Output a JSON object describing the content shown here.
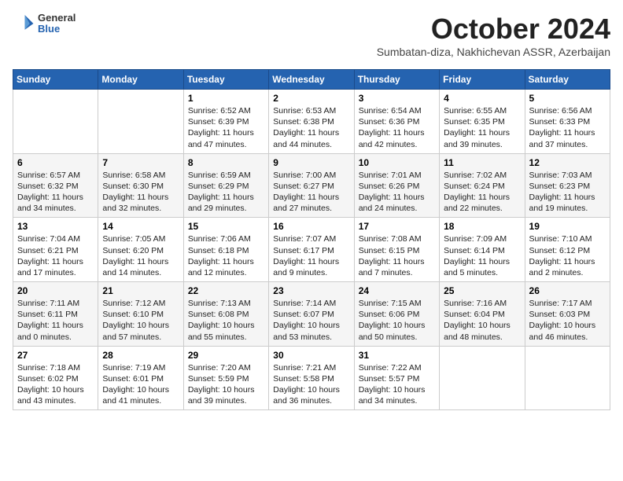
{
  "header": {
    "logo_general": "General",
    "logo_blue": "Blue",
    "month_title": "October 2024",
    "subtitle": "Sumbatan-diza, Nakhichevan ASSR, Azerbaijan"
  },
  "weekdays": [
    "Sunday",
    "Monday",
    "Tuesday",
    "Wednesday",
    "Thursday",
    "Friday",
    "Saturday"
  ],
  "weeks": [
    [
      {
        "day": "",
        "info": ""
      },
      {
        "day": "",
        "info": ""
      },
      {
        "day": "1",
        "info": "Sunrise: 6:52 AM\nSunset: 6:39 PM\nDaylight: 11 hours\nand 47 minutes."
      },
      {
        "day": "2",
        "info": "Sunrise: 6:53 AM\nSunset: 6:38 PM\nDaylight: 11 hours\nand 44 minutes."
      },
      {
        "day": "3",
        "info": "Sunrise: 6:54 AM\nSunset: 6:36 PM\nDaylight: 11 hours\nand 42 minutes."
      },
      {
        "day": "4",
        "info": "Sunrise: 6:55 AM\nSunset: 6:35 PM\nDaylight: 11 hours\nand 39 minutes."
      },
      {
        "day": "5",
        "info": "Sunrise: 6:56 AM\nSunset: 6:33 PM\nDaylight: 11 hours\nand 37 minutes."
      }
    ],
    [
      {
        "day": "6",
        "info": "Sunrise: 6:57 AM\nSunset: 6:32 PM\nDaylight: 11 hours\nand 34 minutes."
      },
      {
        "day": "7",
        "info": "Sunrise: 6:58 AM\nSunset: 6:30 PM\nDaylight: 11 hours\nand 32 minutes."
      },
      {
        "day": "8",
        "info": "Sunrise: 6:59 AM\nSunset: 6:29 PM\nDaylight: 11 hours\nand 29 minutes."
      },
      {
        "day": "9",
        "info": "Sunrise: 7:00 AM\nSunset: 6:27 PM\nDaylight: 11 hours\nand 27 minutes."
      },
      {
        "day": "10",
        "info": "Sunrise: 7:01 AM\nSunset: 6:26 PM\nDaylight: 11 hours\nand 24 minutes."
      },
      {
        "day": "11",
        "info": "Sunrise: 7:02 AM\nSunset: 6:24 PM\nDaylight: 11 hours\nand 22 minutes."
      },
      {
        "day": "12",
        "info": "Sunrise: 7:03 AM\nSunset: 6:23 PM\nDaylight: 11 hours\nand 19 minutes."
      }
    ],
    [
      {
        "day": "13",
        "info": "Sunrise: 7:04 AM\nSunset: 6:21 PM\nDaylight: 11 hours\nand 17 minutes."
      },
      {
        "day": "14",
        "info": "Sunrise: 7:05 AM\nSunset: 6:20 PM\nDaylight: 11 hours\nand 14 minutes."
      },
      {
        "day": "15",
        "info": "Sunrise: 7:06 AM\nSunset: 6:18 PM\nDaylight: 11 hours\nand 12 minutes."
      },
      {
        "day": "16",
        "info": "Sunrise: 7:07 AM\nSunset: 6:17 PM\nDaylight: 11 hours\nand 9 minutes."
      },
      {
        "day": "17",
        "info": "Sunrise: 7:08 AM\nSunset: 6:15 PM\nDaylight: 11 hours\nand 7 minutes."
      },
      {
        "day": "18",
        "info": "Sunrise: 7:09 AM\nSunset: 6:14 PM\nDaylight: 11 hours\nand 5 minutes."
      },
      {
        "day": "19",
        "info": "Sunrise: 7:10 AM\nSunset: 6:12 PM\nDaylight: 11 hours\nand 2 minutes."
      }
    ],
    [
      {
        "day": "20",
        "info": "Sunrise: 7:11 AM\nSunset: 6:11 PM\nDaylight: 11 hours\nand 0 minutes."
      },
      {
        "day": "21",
        "info": "Sunrise: 7:12 AM\nSunset: 6:10 PM\nDaylight: 10 hours\nand 57 minutes."
      },
      {
        "day": "22",
        "info": "Sunrise: 7:13 AM\nSunset: 6:08 PM\nDaylight: 10 hours\nand 55 minutes."
      },
      {
        "day": "23",
        "info": "Sunrise: 7:14 AM\nSunset: 6:07 PM\nDaylight: 10 hours\nand 53 minutes."
      },
      {
        "day": "24",
        "info": "Sunrise: 7:15 AM\nSunset: 6:06 PM\nDaylight: 10 hours\nand 50 minutes."
      },
      {
        "day": "25",
        "info": "Sunrise: 7:16 AM\nSunset: 6:04 PM\nDaylight: 10 hours\nand 48 minutes."
      },
      {
        "day": "26",
        "info": "Sunrise: 7:17 AM\nSunset: 6:03 PM\nDaylight: 10 hours\nand 46 minutes."
      }
    ],
    [
      {
        "day": "27",
        "info": "Sunrise: 7:18 AM\nSunset: 6:02 PM\nDaylight: 10 hours\nand 43 minutes."
      },
      {
        "day": "28",
        "info": "Sunrise: 7:19 AM\nSunset: 6:01 PM\nDaylight: 10 hours\nand 41 minutes."
      },
      {
        "day": "29",
        "info": "Sunrise: 7:20 AM\nSunset: 5:59 PM\nDaylight: 10 hours\nand 39 minutes."
      },
      {
        "day": "30",
        "info": "Sunrise: 7:21 AM\nSunset: 5:58 PM\nDaylight: 10 hours\nand 36 minutes."
      },
      {
        "day": "31",
        "info": "Sunrise: 7:22 AM\nSunset: 5:57 PM\nDaylight: 10 hours\nand 34 minutes."
      },
      {
        "day": "",
        "info": ""
      },
      {
        "day": "",
        "info": ""
      }
    ]
  ]
}
